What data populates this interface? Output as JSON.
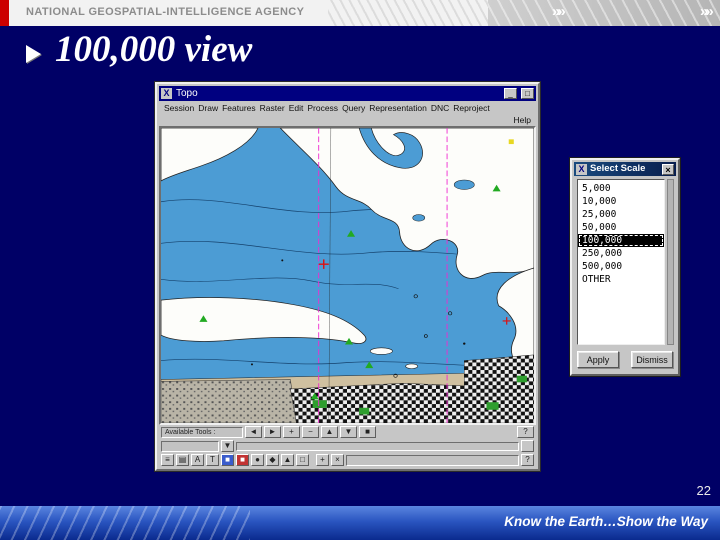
{
  "colors": {
    "slide-bg": "#000066",
    "accent-red": "#cc0000",
    "titlebar-blue": "#000080",
    "water-blue": "#4c9cd4",
    "footer-blue-light": "#5a85e0",
    "footer-blue-dark": "#0a2a8e"
  },
  "header": {
    "agency": "NATIONAL GEOSPATIAL-INTELLIGENCE AGENCY"
  },
  "slide": {
    "title": "100,000 view",
    "page_number": "22",
    "footer": "Know the Earth…Show the Way"
  },
  "icons": {
    "chevrons": "»»",
    "x_logo": "X",
    "minimize": "_",
    "maximize": "□",
    "close": "×",
    "dropdown_arrow": "▼"
  },
  "app_window": {
    "title": "Topo",
    "menus": [
      "Session",
      "Draw",
      "Features",
      "Raster",
      "Edit",
      "Process",
      "Query",
      "Representation",
      "DNC",
      "Reproject"
    ],
    "help_label": "Help",
    "tools_label": "Available Tools :",
    "toolbar_a_glyphs": [
      "◄",
      "►",
      "+",
      "−",
      "▲",
      "▼",
      "■",
      "?"
    ],
    "toolbar_c_glyphs": [
      "≡",
      "▤",
      "A",
      "T",
      "■",
      "■",
      "●",
      "◆",
      "▲",
      "□",
      "+",
      "×",
      "?"
    ]
  },
  "dialog": {
    "title": "Select Scale",
    "options": [
      "5,000",
      "10,000",
      "25,000",
      "50,000",
      "100,000",
      "250,000",
      "500,000",
      "OTHER"
    ],
    "selected_index": 4,
    "apply_label": "Apply",
    "dismiss_label": "Dismiss"
  }
}
